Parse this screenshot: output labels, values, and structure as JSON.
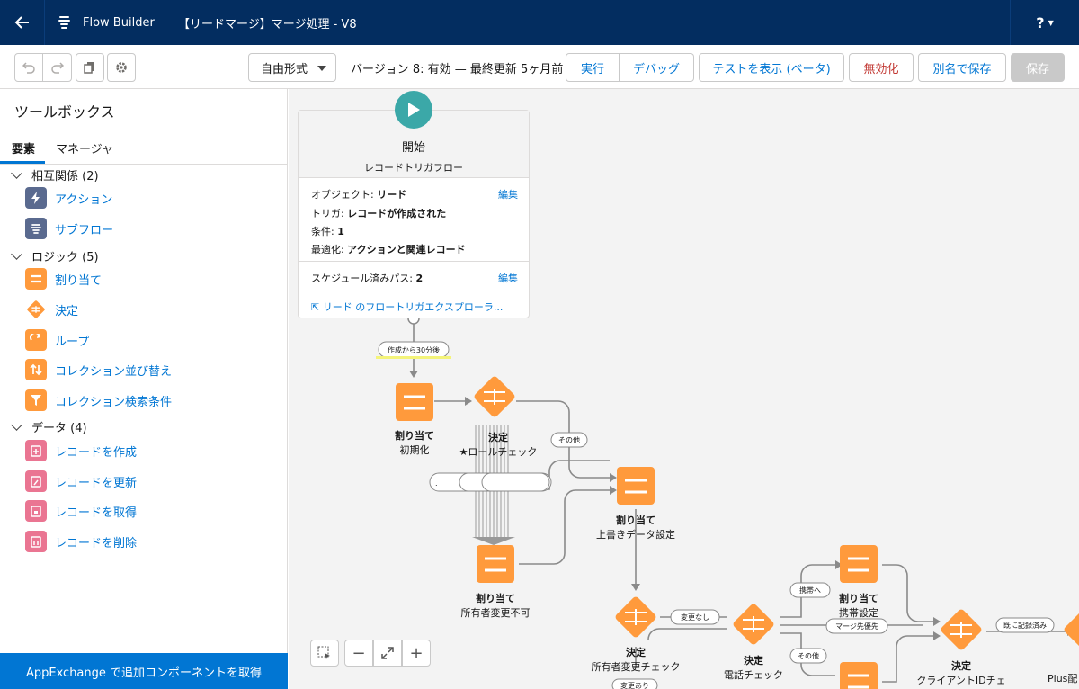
{
  "header": {
    "app_name": "Flow Builder",
    "title": "【リードマージ】マージ処理 - V8",
    "help": "?"
  },
  "toolbar": {
    "mode": "自由形式",
    "version_text": "バージョン 8: 有効 — 最終更新 5ヶ月前",
    "run": "実行",
    "debug": "デバッグ",
    "test": "テストを表示 (ベータ)",
    "deactivate": "無効化",
    "save_as": "別名で保存",
    "save": "保存"
  },
  "sidebar": {
    "title": "ツールボックス",
    "tabs": [
      "要素",
      "マネージャ"
    ],
    "sections": [
      {
        "label": "相互関係 (2)",
        "items": [
          "アクション",
          "サブフロー"
        ]
      },
      {
        "label": "ロジック (5)",
        "items": [
          "割り当て",
          "決定",
          "ループ",
          "コレクション並び替え",
          "コレクション検索条件"
        ]
      },
      {
        "label": "データ (4)",
        "items": [
          "レコードを作成",
          "レコードを更新",
          "レコードを取得",
          "レコードを削除"
        ]
      }
    ],
    "appexchange": "AppExchange で追加コンポーネントを取得"
  },
  "start": {
    "title": "開始",
    "subtitle": "レコードトリガフロー",
    "object_label": "オブジェクト:",
    "object_value": "リード",
    "trigger_label": "トリガ:",
    "trigger_value": "レコードが作成された",
    "condition_label": "条件:",
    "condition_value": "1",
    "optimize_label": "最適化:",
    "optimize_value": "アクションと関連レコード",
    "scheduled_label": "スケジュール済みパス:",
    "scheduled_value": "2",
    "edit": "編集",
    "explorer_link": "リード のフロートリガエクスプローラ..."
  },
  "nodes": {
    "assign_init": {
      "type": "割り当て",
      "name": "初期化"
    },
    "decision_role": {
      "type": "決定",
      "name": "★ロールチェック"
    },
    "assign_overwrite": {
      "type": "割り当て",
      "name": "上書きデータ設定"
    },
    "assign_owner": {
      "type": "割り当て",
      "name": "所有者変更不可"
    },
    "decision_owner": {
      "type": "決定",
      "name": "所有者変更チェック"
    },
    "decision_phone": {
      "type": "決定",
      "name": "電話チェック"
    },
    "assign_mobile": {
      "type": "割り当て",
      "name": "携帯設定"
    },
    "decision_client": {
      "type": "決定",
      "name": "クライアントIDチェ"
    },
    "plus_partial": {
      "name": "Plus配"
    }
  },
  "connector_labels": {
    "after30": "作成から30分後",
    "other1": "その他",
    "nochange": "変更なし",
    "changed": "変更あり",
    "to_mobile": "携帯へ",
    "merge_first": "マージ先優先",
    "other2": "その他",
    "recorded": "既に記録済み"
  },
  "colors": {
    "header_bg": "#032d60",
    "brand_blue": "#0176d3",
    "logic_orange": "#ff9a3c",
    "data_pink": "#ea7592",
    "interaction_slate": "#5a6a8f",
    "start_teal": "#3ba8a8",
    "deactivate_red": "#c23934"
  }
}
